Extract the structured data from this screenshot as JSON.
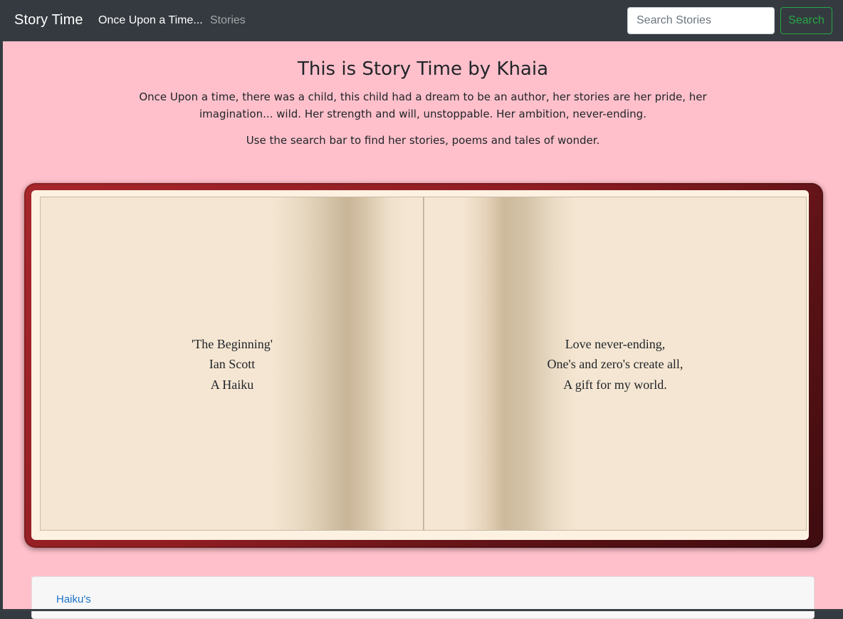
{
  "navbar": {
    "brand": "Story Time",
    "links": [
      {
        "label": "Once Upon a Time...",
        "active": true
      },
      {
        "label": "Stories",
        "active": false
      }
    ],
    "search": {
      "placeholder": "Search Stories",
      "value": "",
      "button_label": "Search"
    }
  },
  "hero": {
    "title": "This is Story Time by Khaia",
    "lead": "Once Upon a time, there was a child, this child had a dream to be an author, her stories are her pride, her imagination... wild. Her strength and will, unstoppable. Her ambition, never-ending.",
    "instruction": "Use the search bar to find her stories, poems and tales of wonder."
  },
  "book": {
    "left_page": {
      "lines": [
        "'The Beginning'",
        "Ian Scott",
        "A Haiku"
      ]
    },
    "right_page": {
      "lines": [
        "Love never-ending,",
        "One's and zero's create all,",
        "A gift for my world."
      ]
    }
  },
  "categories": [
    {
      "label": "Haiku's"
    }
  ],
  "colors": {
    "navbar_bg": "#343a40",
    "page_bg": "#ffc0cb",
    "book_cover": "#8f1d22",
    "book_page": "#f5e6d3",
    "search_button": "#28a745",
    "link": "#1a73c9"
  }
}
